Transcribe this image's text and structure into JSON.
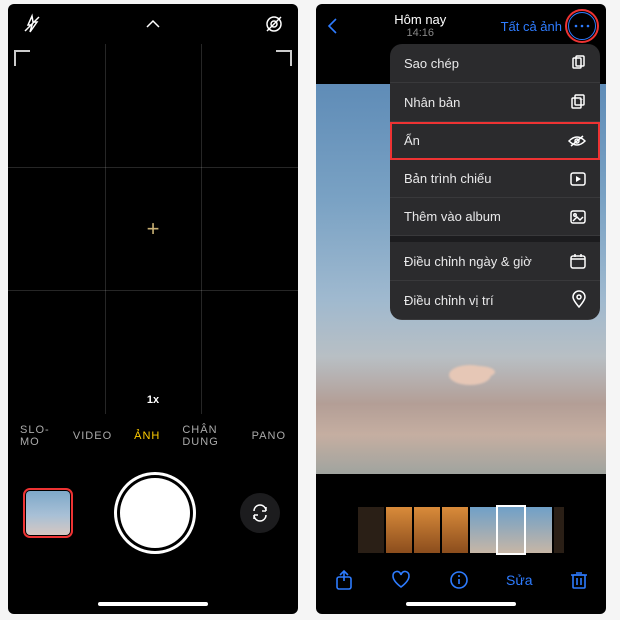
{
  "camera": {
    "zoom_label": "1x",
    "modes": [
      "SLO-MO",
      "VIDEO",
      "ẢNH",
      "CHÂN DUNG",
      "PANO"
    ],
    "active_mode_index": 2
  },
  "photos": {
    "header": {
      "title": "Hôm nay",
      "time": "14:16",
      "deselect": "Tất cả ảnh"
    },
    "menu": {
      "items": [
        {
          "label": "Sao chép",
          "icon": "copy-icon"
        },
        {
          "label": "Nhân bản",
          "icon": "duplicate-icon"
        },
        {
          "label": "Ẩn",
          "icon": "hide-icon",
          "highlight": true
        },
        {
          "label": "Bản trình chiếu",
          "icon": "slideshow-icon"
        },
        {
          "label": "Thêm vào album",
          "icon": "add-album-icon"
        },
        {
          "label": "Điều chỉnh ngày & giờ",
          "icon": "adjust-date-icon"
        },
        {
          "label": "Điều chỉnh vị trí",
          "icon": "adjust-location-icon"
        }
      ]
    },
    "toolbar": {
      "edit_label": "Sửa"
    }
  }
}
